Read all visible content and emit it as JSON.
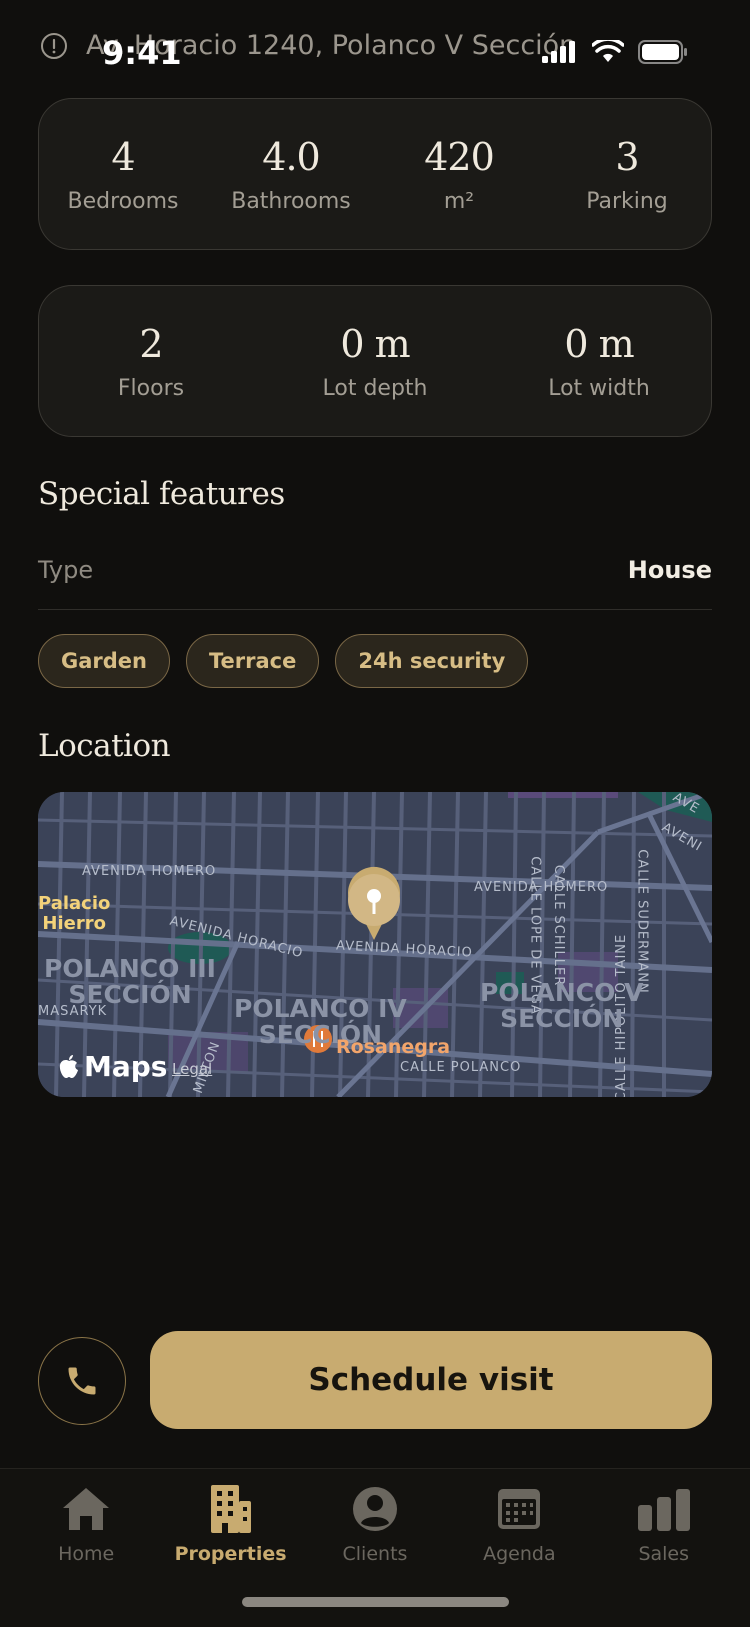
{
  "status_bar": {
    "time": "9:41",
    "address": "Av. Horacio 1240, Polanco V Sección"
  },
  "stats_primary": [
    {
      "value": "4",
      "label": "Bedrooms"
    },
    {
      "value": "4.0",
      "label": "Bathrooms"
    },
    {
      "value": "420",
      "label": "m²"
    },
    {
      "value": "3",
      "label": "Parking"
    }
  ],
  "stats_secondary": [
    {
      "value": "2",
      "label": "Floors"
    },
    {
      "value": "0 m",
      "label": "Lot depth"
    },
    {
      "value": "0 m",
      "label": "Lot width"
    }
  ],
  "special_features": {
    "title": "Special features",
    "type_label": "Type",
    "type_value": "House",
    "chips": [
      "Garden",
      "Terrace",
      "24h security"
    ]
  },
  "location": {
    "title": "Location",
    "map": {
      "streets": {
        "homero_left": "AVENIDA HOMERO",
        "homero_right": "AVENIDA HOMERO",
        "horacio_left": "AVENIDA HORACIO",
        "horacio_right": "AVENIDA HORACIO",
        "lope_de_vega": "CALLE LOPE DE VEGA",
        "schiller": "CALLE SCHILLER",
        "sudermann": "CALLE SUDERMANN",
        "hipolito_taine": "CALLE HIPÓLITO TAINE",
        "polanco": "CALLE POLANCO",
        "masaryk": "MASARYK",
        "corner_top": "AVE",
        "corner_right": "AVENI",
        "milton": "MILTON",
        "ave_small": "AVENIDA"
      },
      "neighborhoods": {
        "polanco_iii": "POLANCO III\nSECCIÓN",
        "polanco_iv": "POLANCO IV\nSECCIÓN",
        "polanco_v": "POLANCO V\nSECCIÓN"
      },
      "poi_palacio": "Palacio\nHierro",
      "poi_restaurant": "Rosanegra",
      "logo": "Maps",
      "legal": "Legal"
    }
  },
  "actions": {
    "schedule": "Schedule visit"
  },
  "tab_bar": {
    "items": [
      {
        "label": "Home",
        "icon": "house-icon",
        "active": false
      },
      {
        "label": "Properties",
        "icon": "building-icon",
        "active": true
      },
      {
        "label": "Clients",
        "icon": "person-circle-icon",
        "active": false
      },
      {
        "label": "Agenda",
        "icon": "calendar-icon",
        "active": false
      },
      {
        "label": "Sales",
        "icon": "chart-bars-icon",
        "active": false
      }
    ]
  },
  "colors": {
    "accent": "#c8ab70",
    "background": "#100f0d",
    "card": "#1b1a17"
  }
}
